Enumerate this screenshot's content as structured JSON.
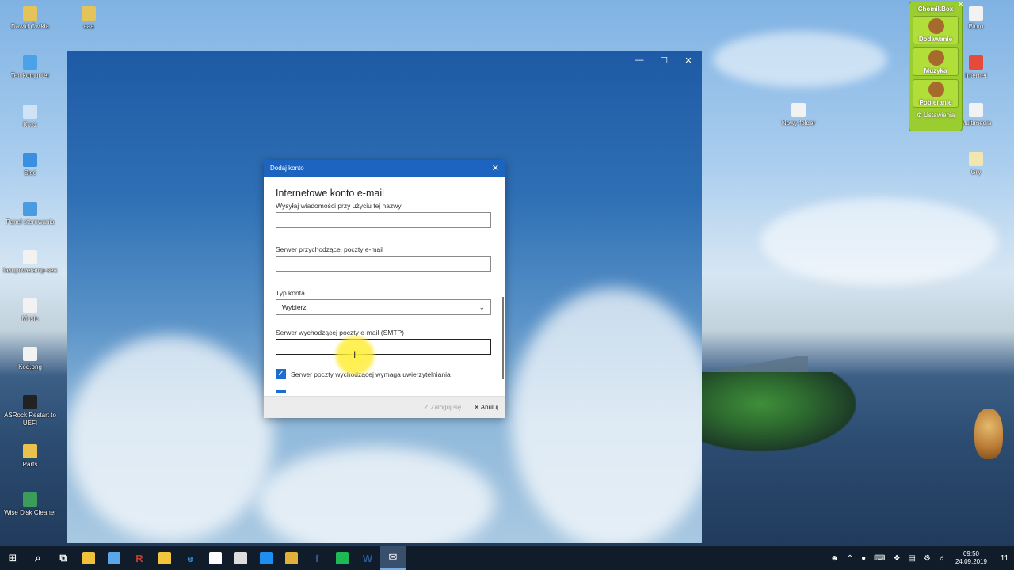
{
  "desktop": {
    "icons_left": [
      {
        "label": "Dawid Ćwikła",
        "color": "#e3c35a"
      },
      {
        "label": "Ten komputer",
        "color": "#4aa3e8"
      },
      {
        "label": "Kosz",
        "color": "#cfe3f5"
      },
      {
        "label": "Sieć",
        "color": "#3a8fe0"
      },
      {
        "label": "Panel sterowania",
        "color": "#4b9be0"
      },
      {
        "label": "Iasupoweramp-sea",
        "color": "#f2f2f2"
      },
      {
        "label": "Music",
        "color": "#f2f2f2"
      },
      {
        "label": "Kod.png",
        "color": "#f2f2f2"
      },
      {
        "label": "ASRock Restart to UEFI",
        "color": "#222222"
      },
      {
        "label": "Parts",
        "color": "#e9c24d"
      },
      {
        "label": "Wise Disk Cleaner",
        "color": "#3a9e5a"
      }
    ],
    "icon_aaa": {
      "label": "aaa",
      "color": "#e3c35a"
    },
    "icon_nowy_folder": {
      "label": "Nowy folder",
      "color": "#f2f2f2"
    },
    "icons_right": [
      {
        "label": "Biuro",
        "color": "#f2f2f2"
      },
      {
        "label": "Internet",
        "color": "#e44b3a"
      },
      {
        "label": "Multimedia",
        "color": "#f2f2f2"
      },
      {
        "label": "Gry",
        "color": "#f2e6b0"
      }
    ]
  },
  "app_window": {
    "controls": {
      "minimize": "—",
      "maximize": "☐",
      "close": "✕"
    }
  },
  "dialog": {
    "title": "Dodaj konto",
    "close": "✕",
    "heading": "Internetowe konto e-mail",
    "fields": {
      "send_name_label": "Wysyłaj wiadomości przy użyciu tej nazwy",
      "send_name_value": "",
      "incoming_label": "Serwer przychodzącej poczty e-mail",
      "incoming_value": "",
      "account_type_label": "Typ konta",
      "account_type_value": "Wybierz",
      "smtp_label": "Serwer wychodzącej poczty e-mail (SMTP)",
      "smtp_value": ""
    },
    "checkbox_label": "Serwer poczty wychodzącej wymaga uwierzytelniania",
    "checkbox_checked": true,
    "footer": {
      "signin_label": "Zaloguj się",
      "cancel_label": "Anuluj"
    }
  },
  "chomikbox": {
    "title": "ChomikBox",
    "buttons": [
      "Dodawanie",
      "Muzyka",
      "Pobieranie"
    ],
    "settings": "Ustawienia",
    "close": "✕"
  },
  "taskbar": {
    "start_icon": "windows-start-icon",
    "items": [
      {
        "name": "search",
        "glyph": "⌕",
        "color": "#ffffff"
      },
      {
        "name": "task-view",
        "glyph": "⧉",
        "color": "#ffffff"
      },
      {
        "name": "file-explorer",
        "glyph": "",
        "color": "#f0c23b"
      },
      {
        "name": "remote-desktop",
        "glyph": "",
        "color": "#5ba6e8"
      },
      {
        "name": "app-r",
        "glyph": "R",
        "color": "#c83b2c"
      },
      {
        "name": "app-face",
        "glyph": "",
        "color": "#f2c53d"
      },
      {
        "name": "edge",
        "glyph": "e",
        "color": "#2f8de4"
      },
      {
        "name": "store",
        "glyph": "",
        "color": "#ffffff"
      },
      {
        "name": "calculator",
        "glyph": "",
        "color": "#dddddd"
      },
      {
        "name": "messenger",
        "glyph": "",
        "color": "#1f8ef1"
      },
      {
        "name": "chrome",
        "glyph": "",
        "color": "#e0b03a"
      },
      {
        "name": "facebook",
        "glyph": "f",
        "color": "#3b5998"
      },
      {
        "name": "spotify",
        "glyph": "",
        "color": "#1db954"
      },
      {
        "name": "word",
        "glyph": "W",
        "color": "#2b579a"
      },
      {
        "name": "mail",
        "glyph": "✉",
        "color": "#ffffff"
      }
    ],
    "clock_time": "09:50",
    "clock_date": "24.09.2019",
    "notification_count": "11"
  }
}
